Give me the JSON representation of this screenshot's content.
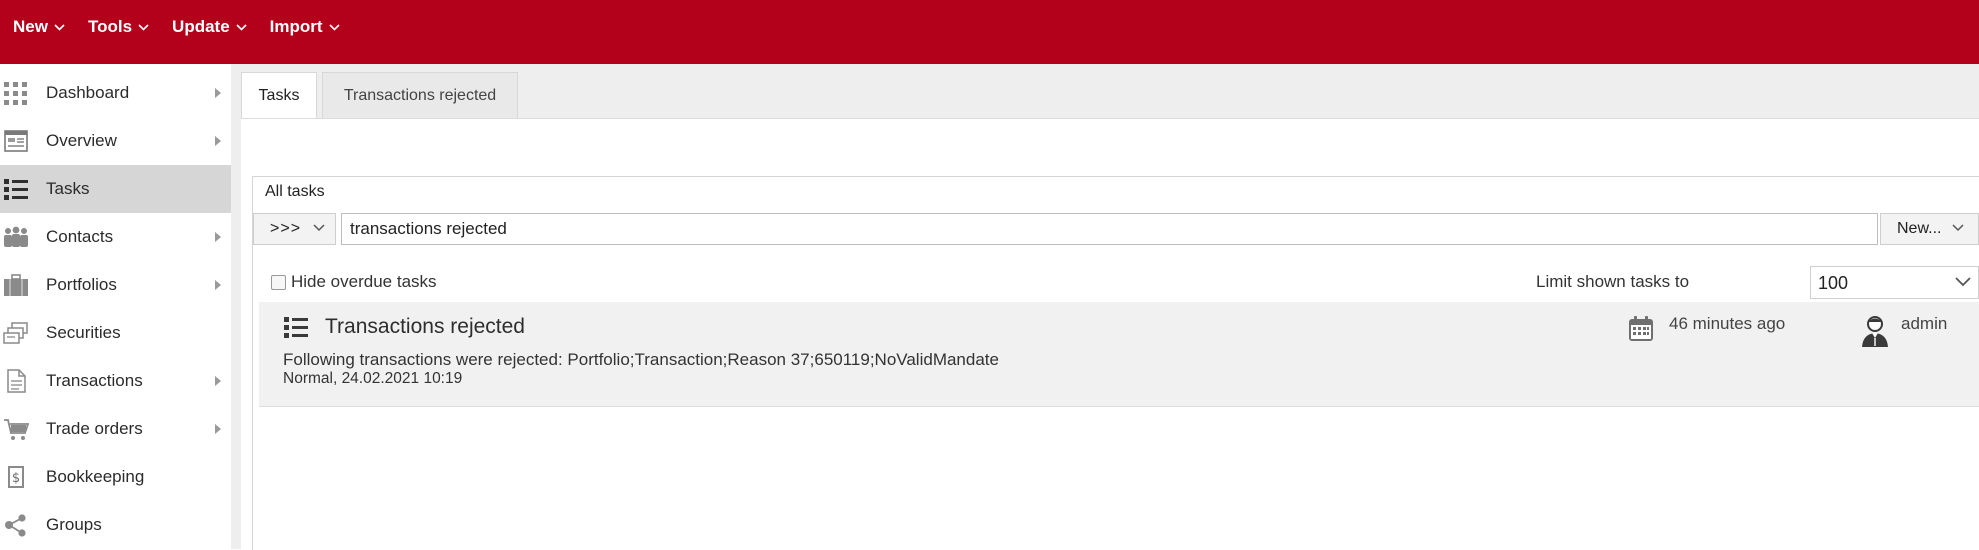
{
  "topmenu": {
    "items": [
      {
        "label": "New"
      },
      {
        "label": "Tools"
      },
      {
        "label": "Update"
      },
      {
        "label": "Import"
      }
    ]
  },
  "sidebar": {
    "items": [
      {
        "label": "Dashboard",
        "icon": "dashboard-grid-icon"
      },
      {
        "label": "Overview",
        "icon": "overview-icon"
      },
      {
        "label": "Tasks",
        "icon": "tasks-list-icon",
        "active": true
      },
      {
        "label": "Contacts",
        "icon": "contacts-people-icon"
      },
      {
        "label": "Portfolios",
        "icon": "briefcase-icon"
      },
      {
        "label": "Securities",
        "icon": "securities-stack-icon"
      },
      {
        "label": "Transactions",
        "icon": "document-icon"
      },
      {
        "label": "Trade orders",
        "icon": "cart-icon"
      },
      {
        "label": "Bookkeeping",
        "icon": "ledger-dollar-icon"
      },
      {
        "label": "Groups",
        "icon": "share-nodes-icon"
      }
    ]
  },
  "tabs": [
    {
      "label": "Tasks",
      "active": true
    },
    {
      "label": "Transactions rejected",
      "active": false
    }
  ],
  "panel": {
    "title": "All tasks",
    "scope_label": ">>>",
    "search_value": "transactions rejected",
    "new_button_label": "New...",
    "hide_overdue_label": "Hide overdue tasks",
    "hide_overdue_checked": false,
    "limit_label": "Limit shown tasks to",
    "limit_value": "100"
  },
  "tasks": [
    {
      "title": "Transactions rejected",
      "description": "Following transactions were rejected: Portfolio;Transaction;Reason 37;650119;NoValidMandate",
      "meta": "Normal, 24.02.2021 10:19",
      "time_ago": "46 minutes ago",
      "user": "admin"
    }
  ],
  "colors": {
    "brand_red": "#b3001b",
    "sidebar_active": "#d6d6d6",
    "task_row_bg": "#f1f1f1",
    "icon_gray": "#7a7a7a"
  }
}
